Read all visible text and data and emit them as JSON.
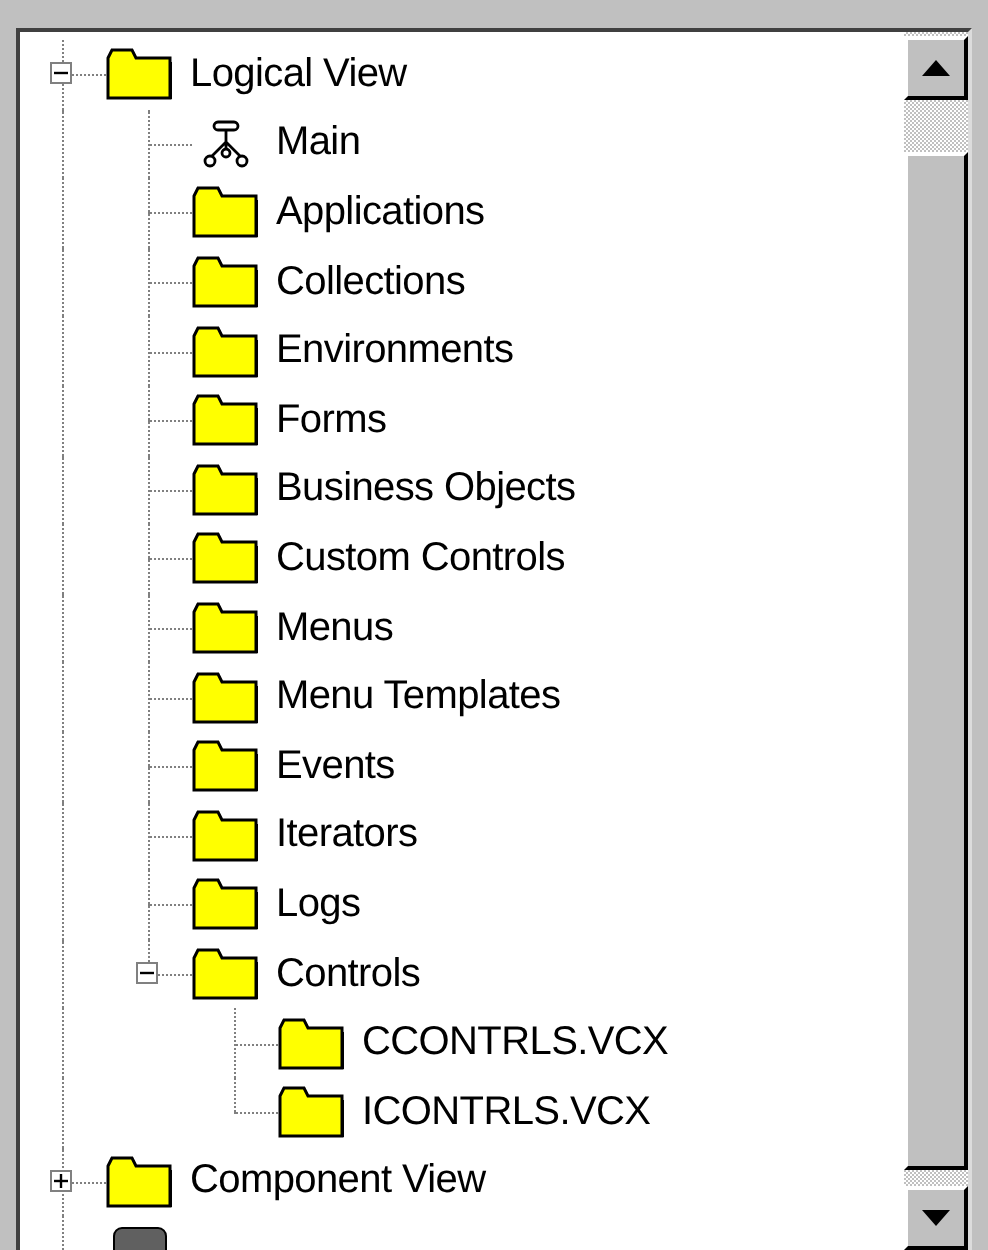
{
  "tree": [
    {
      "label": "Logical View",
      "kind": "folder",
      "expanded": true,
      "children": [
        {
          "label": "Main",
          "kind": "diagram"
        },
        {
          "label": "Applications",
          "kind": "folder"
        },
        {
          "label": "Collections",
          "kind": "folder"
        },
        {
          "label": "Environments",
          "kind": "folder"
        },
        {
          "label": "Forms",
          "kind": "folder"
        },
        {
          "label": "Business Objects",
          "kind": "folder"
        },
        {
          "label": "Custom Controls",
          "kind": "folder"
        },
        {
          "label": "Menus",
          "kind": "folder"
        },
        {
          "label": "Menu Templates",
          "kind": "folder"
        },
        {
          "label": "Events",
          "kind": "folder"
        },
        {
          "label": "Iterators",
          "kind": "folder"
        },
        {
          "label": "Logs",
          "kind": "folder"
        },
        {
          "label": "Controls",
          "kind": "folder",
          "expanded": true,
          "children": [
            {
              "label": "CCONTRLS.VCX",
              "kind": "folder"
            },
            {
              "label": "ICONTRLS.VCX",
              "kind": "folder"
            }
          ]
        }
      ]
    },
    {
      "label": "Component View",
      "kind": "folder",
      "expanded": false
    }
  ]
}
